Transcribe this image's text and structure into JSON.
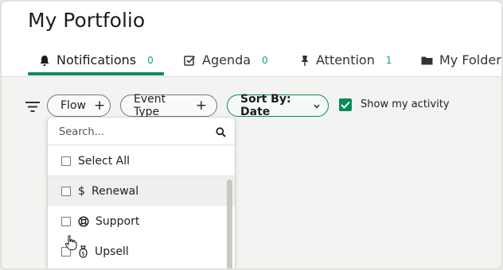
{
  "header": {
    "title": "My Portfolio",
    "tabs": [
      {
        "label": "Notifications",
        "count": "0",
        "icon": "bell-icon"
      },
      {
        "label": "Agenda",
        "count": "0",
        "icon": "checkbox-icon"
      },
      {
        "label": "Attention",
        "count": "1",
        "icon": "pin-icon"
      },
      {
        "label": "My Folder",
        "count": "",
        "icon": "folder-icon"
      }
    ]
  },
  "toolbar": {
    "filter_icon": "filter-icon",
    "chips": [
      {
        "label": "Flow",
        "suffix": "+"
      },
      {
        "label": "Event Type",
        "suffix": "+"
      },
      {
        "label": "Sort By: Date",
        "suffix": "chevron-down-icon"
      }
    ],
    "show_activity": {
      "label": "Show my activity",
      "checked": true
    }
  },
  "dropdown": {
    "search_placeholder": "Search...",
    "select_all": "Select All",
    "items": [
      {
        "label": "Renewal",
        "icon": "dollar-icon",
        "checked": false,
        "hovered": true
      },
      {
        "label": "Support",
        "icon": "lifebuoy-icon",
        "checked": false,
        "hovered": false
      },
      {
        "label": "Upsell",
        "icon": "money-bag-icon",
        "checked": false,
        "hovered": false
      }
    ]
  },
  "colors": {
    "accent": "#0a8a5a",
    "count": "#14a06b",
    "background": "#f3f3f1"
  }
}
